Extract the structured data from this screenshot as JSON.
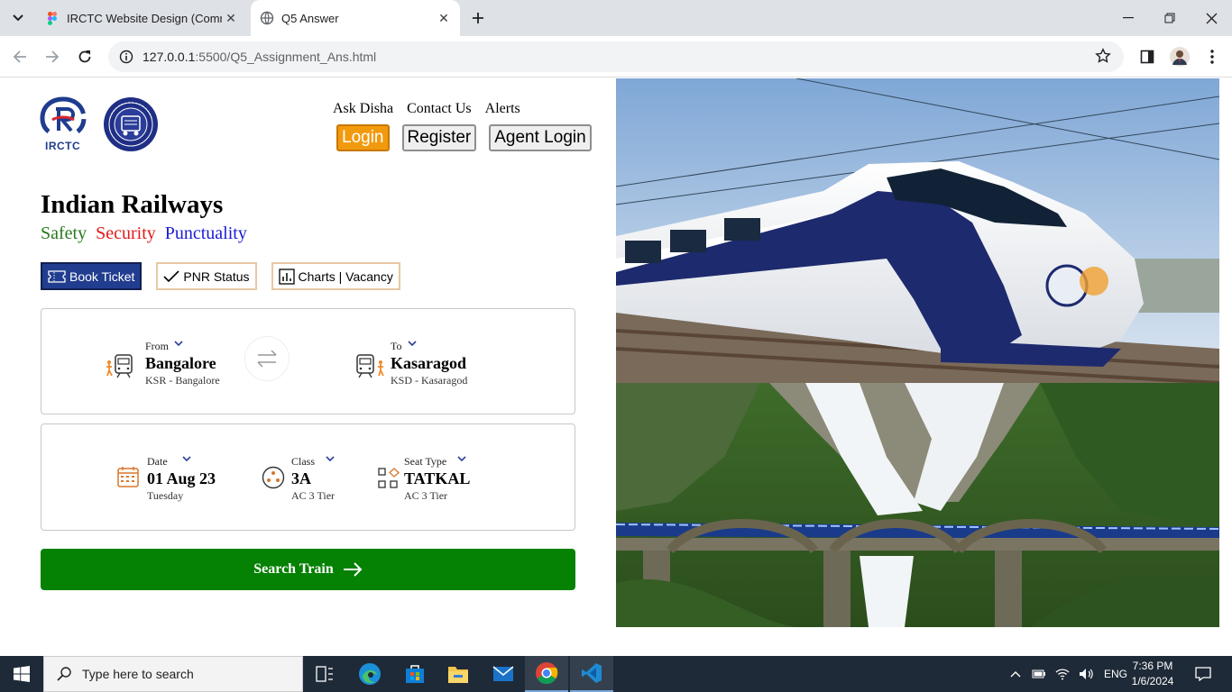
{
  "browser": {
    "tabs": [
      {
        "title": "IRCTC Website Design (Commu"
      },
      {
        "title": "Q5 Answer"
      }
    ],
    "url_host": "127.0.0.1",
    "url_path": ":5500/Q5_Assignment_Ans.html"
  },
  "header": {
    "irctc_logo_text": "IRCTC",
    "links": [
      "Ask Disha",
      "Contact Us",
      "Alerts"
    ],
    "login": "Login",
    "register": "Register",
    "agent_login": "Agent Login"
  },
  "hero": {
    "title": "Indian Railways",
    "tagline": [
      "Safety",
      "Security",
      "Punctuality"
    ],
    "colors": {
      "safety": "#2a7a1e",
      "security": "#e21b1b",
      "punctuality": "#1b1bd6"
    }
  },
  "modes": {
    "book_ticket": "Book Ticket",
    "pnr_status": "PNR Status",
    "charts_vacancy": "Charts | Vacancy"
  },
  "journey": {
    "from": {
      "label": "From",
      "station": "Bangalore",
      "code": "KSR - Bangalore"
    },
    "to": {
      "label": "To",
      "station": "Kasaragod",
      "code": "KSD - Kasaragod"
    }
  },
  "options": {
    "date": {
      "label": "Date",
      "value": "01 Aug 23",
      "sub": "Tuesday"
    },
    "class": {
      "label": "Class",
      "value": "3A",
      "sub": "AC 3 Tier"
    },
    "seat": {
      "label": "Seat Type",
      "value": "TATKAL",
      "sub": "AC 3 Tier"
    }
  },
  "search_button": "Search Train",
  "taskbar": {
    "search_placeholder": "Type here to search",
    "language": "ENG",
    "time": "7:36 PM",
    "date": "1/6/2024"
  }
}
